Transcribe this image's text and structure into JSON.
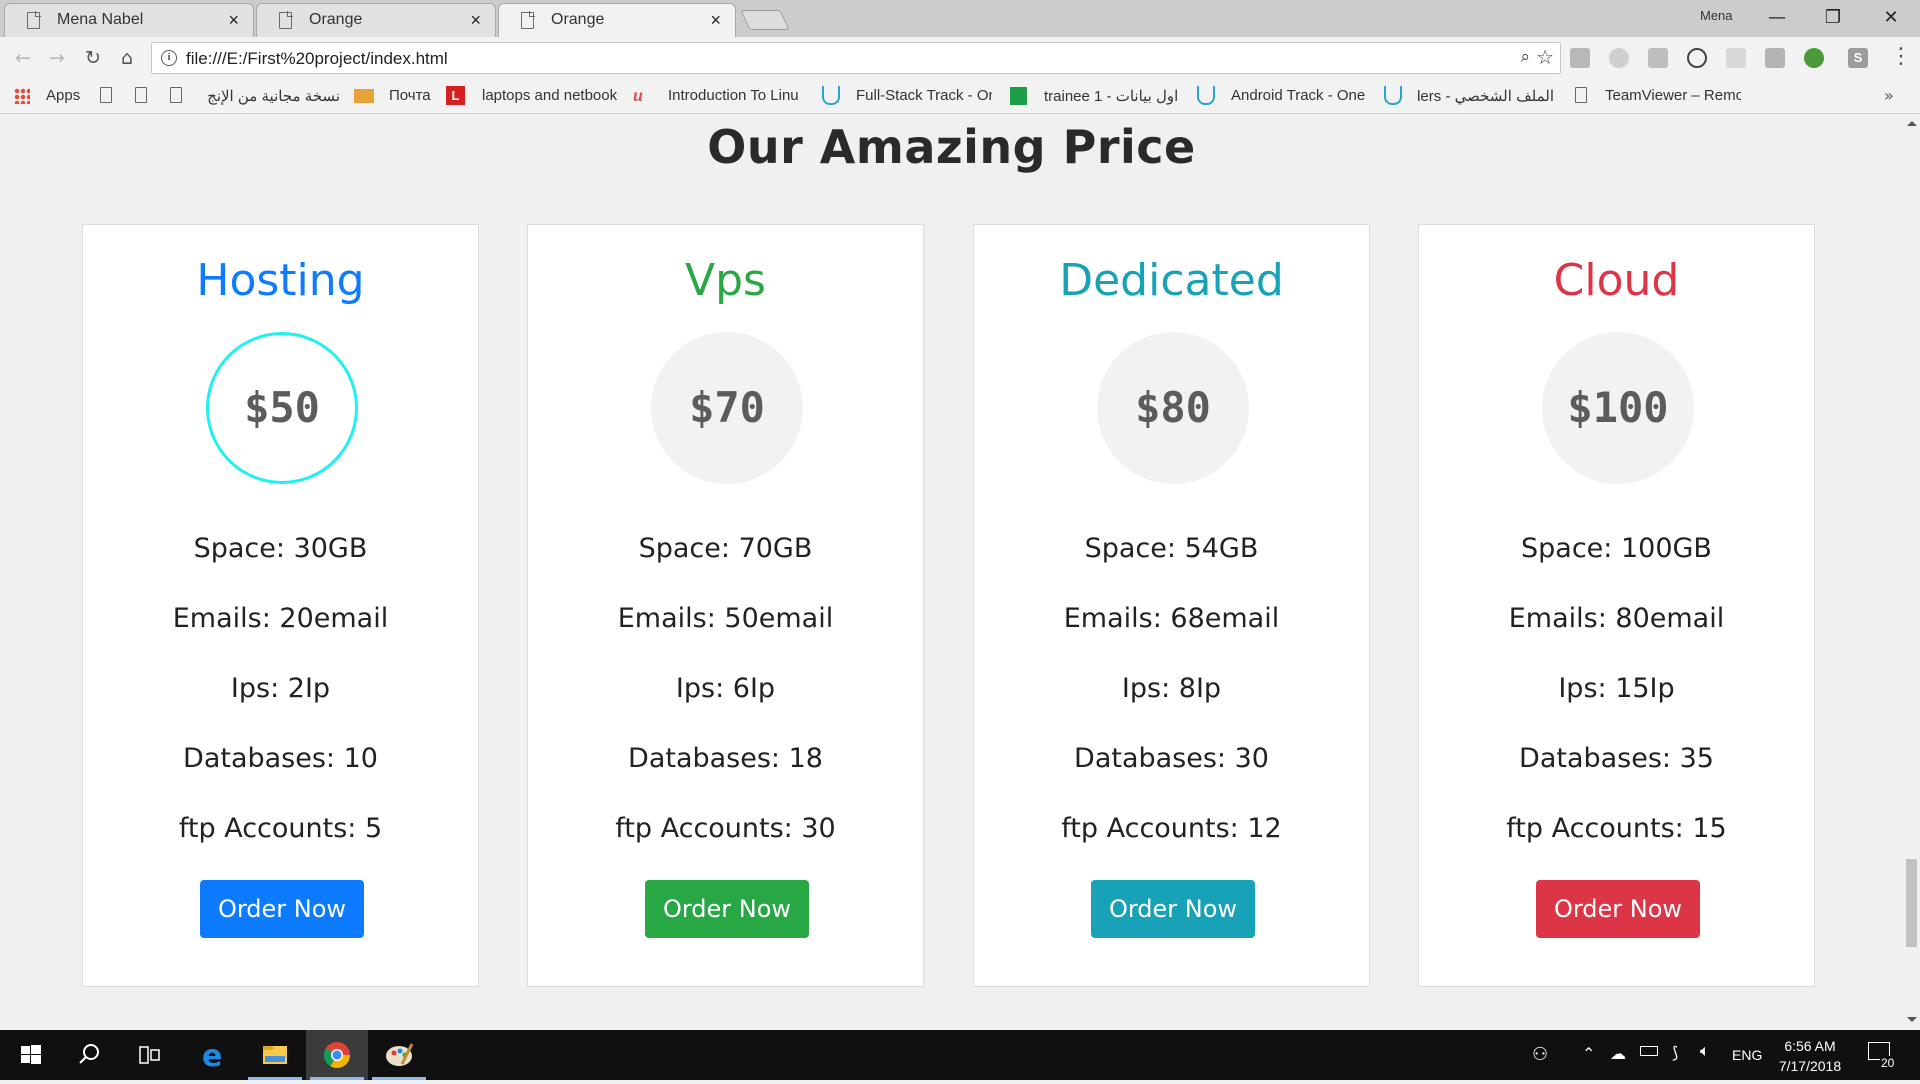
{
  "browser": {
    "tabs": [
      {
        "title": "Mena Nabel",
        "close": "×"
      },
      {
        "title": "Orange",
        "close": "×"
      },
      {
        "title": "Orange",
        "close": "×"
      }
    ],
    "profile_name": "Mena",
    "url": "file:///E:/First%20project/index.html",
    "bookmarks": [
      "Apps",
      "نسخة مجانية من الإنج",
      "Почта",
      "laptops and netbook",
      "Introduction To Linu",
      "Full-Stack Track - On",
      "trainee 1 - اول بيانات",
      "Android Track - One",
      "الملف الشخصي - ders",
      "TeamViewer – Remo"
    ]
  },
  "page": {
    "section_title": "Our Amazing Price",
    "plans": [
      {
        "name": "Hosting",
        "price": "$50",
        "color": "#0d7bff",
        "features": [
          "Space: 30GB",
          "Emails: 20email",
          "Ips: 2Ip",
          "Databases: 10",
          "ftp Accounts: 5"
        ],
        "button": "Order Now",
        "highlighted": true
      },
      {
        "name": "Vps",
        "price": "$70",
        "color": "#28a745",
        "features": [
          "Space: 70GB",
          "Emails: 50email",
          "Ips: 6Ip",
          "Databases: 18",
          "ftp Accounts: 30"
        ],
        "button": "Order Now",
        "highlighted": false
      },
      {
        "name": "Dedicated",
        "price": "$80",
        "color": "#17a2b8",
        "features": [
          "Space: 54GB",
          "Emails: 68email",
          "Ips: 8Ip",
          "Databases: 30",
          "ftp Accounts: 12"
        ],
        "button": "Order Now",
        "highlighted": false
      },
      {
        "name": "Cloud",
        "price": "$100",
        "color": "#dc3545",
        "features": [
          "Space: 100GB",
          "Emails: 80email",
          "Ips: 15Ip",
          "Databases: 35",
          "ftp Accounts: 15"
        ],
        "button": "Order Now",
        "highlighted": false
      }
    ]
  },
  "taskbar": {
    "language": "ENG",
    "time": "6:56 AM",
    "date": "7/17/2018",
    "notifications": "20"
  }
}
